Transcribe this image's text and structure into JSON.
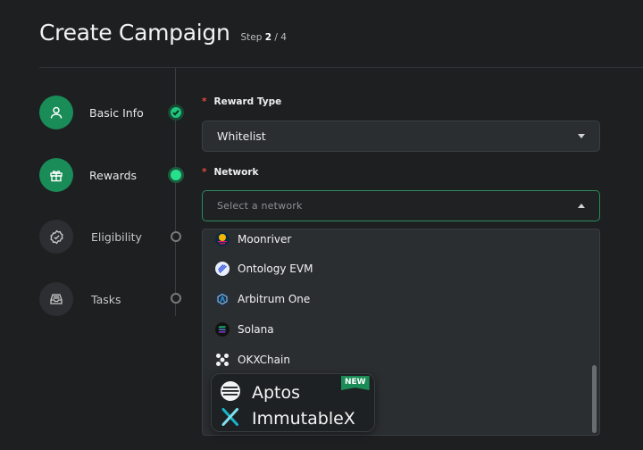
{
  "header": {
    "title": "Create Campaign",
    "step_prefix": "Step",
    "step_current": "2",
    "step_total": "/ 4"
  },
  "stepper": [
    {
      "label": "Basic Info",
      "state": "done"
    },
    {
      "label": "Rewards",
      "state": "current"
    },
    {
      "label": "Eligibility",
      "state": "todo"
    },
    {
      "label": "Tasks",
      "state": "todo"
    }
  ],
  "form": {
    "reward_type": {
      "required_mark": "*",
      "label": "Reward Type",
      "value": "Whitelist"
    },
    "network": {
      "required_mark": "*",
      "label": "Network",
      "placeholder": "Select a network"
    }
  },
  "network_options": [
    "Moonriver",
    "Ontology EVM",
    "Arbitrum One",
    "Solana",
    "OKXChain"
  ],
  "highlight": {
    "items": [
      "Aptos",
      "ImmutableX"
    ],
    "badge": "NEW"
  },
  "colors": {
    "accent": "#1a8c57",
    "active_dot": "#27e08c",
    "required": "#e14b3b",
    "background": "#1d1f21"
  }
}
